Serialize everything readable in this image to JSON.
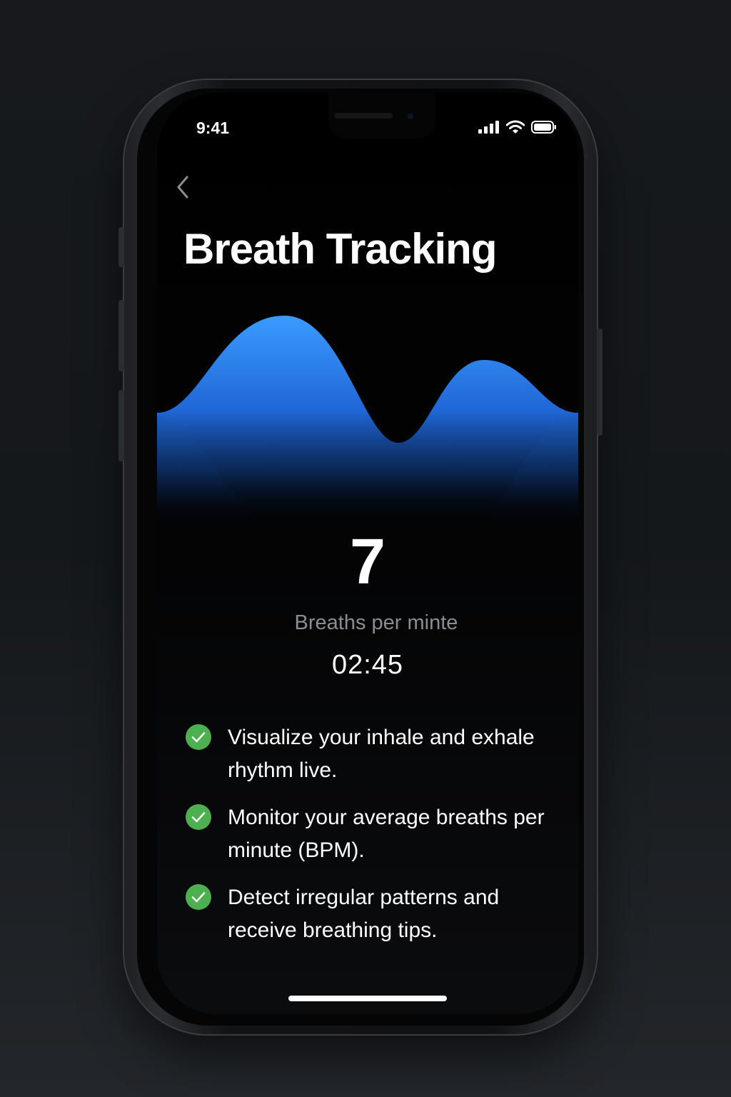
{
  "status_bar": {
    "time": "9:41",
    "icons": [
      "signal-icon",
      "wifi-icon",
      "battery-icon"
    ]
  },
  "header": {
    "back_icon": "chevron-left-icon",
    "title": "Breath Tracking"
  },
  "wave": {
    "colors": {
      "top": "#3a9bff",
      "mid": "#1f66d6",
      "fade": "#0b2a5c"
    }
  },
  "stats": {
    "bpm_value": "7",
    "bpm_label": "Breaths per minte",
    "timer": "02:45"
  },
  "features": [
    {
      "icon": "check-circle-icon",
      "text": "Visualize your inhale and exhale rhythm live."
    },
    {
      "icon": "check-circle-icon",
      "text": "Monitor your average breaths per minute (BPM)."
    },
    {
      "icon": "check-circle-icon",
      "text": "Detect irregular patterns and receive breathing tips."
    }
  ],
  "colors": {
    "background": "#000000",
    "accent_blue": "#2f86f0",
    "check_green": "#4caf50",
    "muted_text": "#8a8d92"
  }
}
